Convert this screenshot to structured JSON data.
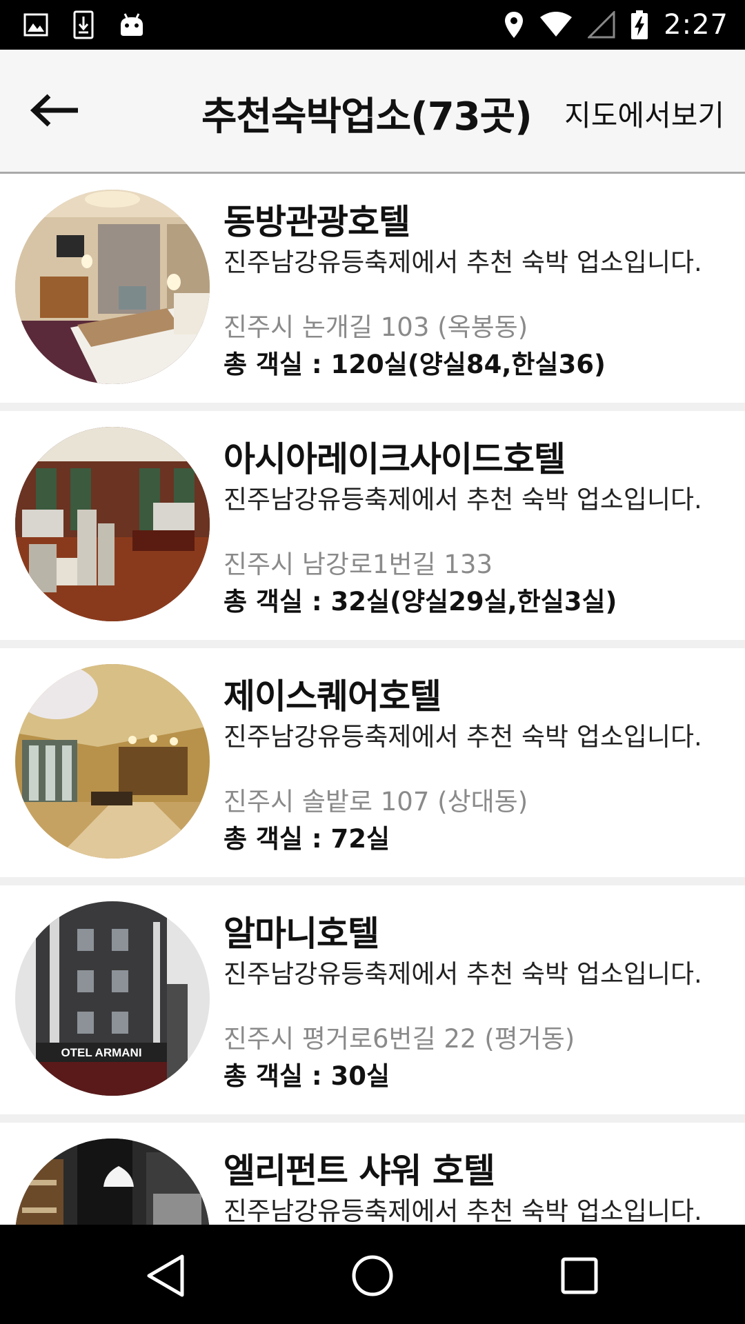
{
  "status_bar": {
    "time": "2:27",
    "left_icons": [
      "image-icon",
      "download-icon",
      "android-icon"
    ],
    "right_icons": [
      "location-icon",
      "wifi-icon",
      "signal-icon",
      "battery-icon"
    ]
  },
  "app_bar": {
    "back_icon": "arrow-left-icon",
    "title": "추천숙박업소(73곳)",
    "map_link": "지도에서보기"
  },
  "hotels": [
    {
      "name": "동방관광호텔",
      "description": "진주남강유등축제에서 추천 숙박 업소입니다.",
      "address": "진주시 논개길 103 (옥봉동)",
      "rooms": "총 객실 : 120실(양실84,한실36)",
      "photo": "hotel-bedroom-photo"
    },
    {
      "name": "아시아레이크사이드호텔",
      "description": "진주남강유등축제에서 추천 숙박 업소입니다.",
      "address": "진주시 남강로1번길 133",
      "rooms": "총 객실 : 32실(양실29실,한실3실)",
      "photo": "hotel-restaurant-photo"
    },
    {
      "name": "제이스퀘어호텔",
      "description": "진주남강유등축제에서 추천 숙박 업소입니다.",
      "address": "진주시 솔밭로 107 (상대동)",
      "rooms": "총 객실 : 72실",
      "photo": "hotel-lobby-photo"
    },
    {
      "name": "알마니호텔",
      "description": "진주남강유등축제에서 추천 숙박 업소입니다.",
      "address": "진주시 평거로6번길 22 (평거동)",
      "rooms": "총 객실 : 30실",
      "photo": "hotel-exterior-photo",
      "photo_sign": "OTEL ARMANI"
    },
    {
      "name": "엘리펀트 샤워 호텔",
      "description": "진주남강유등축제에서 추천 숙박 업소입니다.",
      "address": "",
      "rooms": "",
      "photo": "hotel-cafe-photo"
    }
  ],
  "nav_bar": {
    "icons": [
      "nav-back-icon",
      "nav-home-icon",
      "nav-recents-icon"
    ]
  },
  "colors": {
    "status_bar_bg": "#000000",
    "app_bar_bg": "#f6f6f6",
    "address_text": "#8a8a8a",
    "divider": "#f0f0f0"
  }
}
